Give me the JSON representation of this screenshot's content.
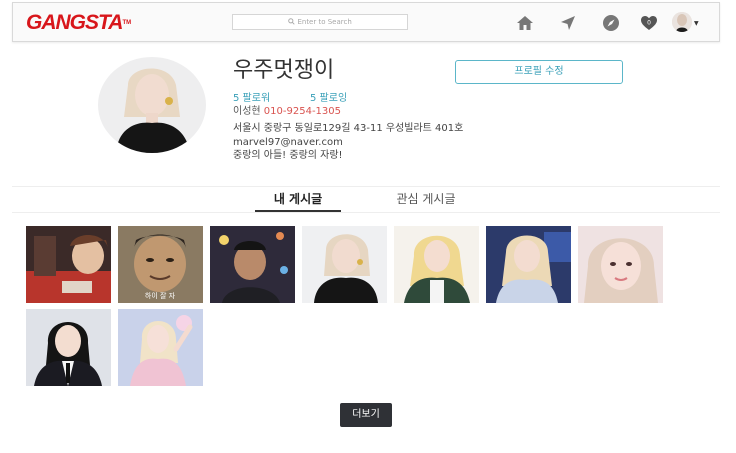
{
  "navbar": {
    "logo_text": "GANGSTA",
    "logo_suffix": "TM",
    "search_placeholder": "Enter to Search",
    "notification_count": "0"
  },
  "profile": {
    "username": "우주멋쟁이",
    "edit_button_label": "프로필 수정",
    "followers_label": "5 팔로워",
    "following_label": "5 팔로잉",
    "real_name": "이성현",
    "phone": "010-9254-1305",
    "address": "서울시 중랑구 동일로129길 43-11 우성빌라트 401호",
    "email": "marvel97@naver.com",
    "bio": "중랑의 아들! 중랑의 자랑!"
  },
  "tabs": [
    {
      "label": "내 게시글"
    },
    {
      "label": "관심 게시글"
    }
  ],
  "posts": [
    {
      "caption": ""
    },
    {
      "caption": "하이 잘 자"
    },
    {
      "caption": ""
    },
    {
      "caption": ""
    },
    {
      "caption": ""
    },
    {
      "caption": ""
    },
    {
      "caption": ""
    },
    {
      "caption": ""
    },
    {
      "caption": ""
    }
  ],
  "load_more_label": "더보기",
  "colors": {
    "brand": "#d8161b",
    "accent": "#3aa0b8",
    "phone": "#d9534f",
    "button_dark": "#2f3136"
  }
}
